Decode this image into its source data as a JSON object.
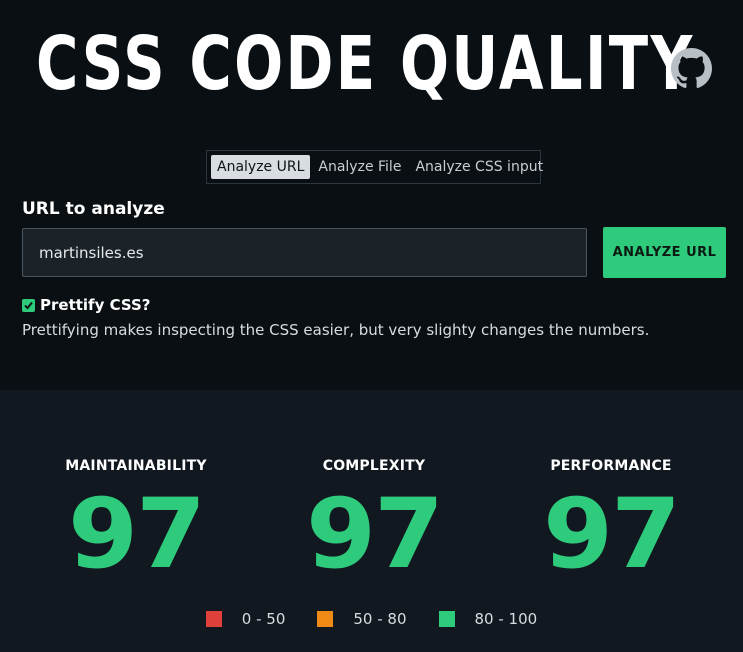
{
  "header": {
    "title": "CSS CODE QUALITY",
    "github_icon": "github-icon"
  },
  "tabs": [
    {
      "label": "Analyze URL",
      "active": true
    },
    {
      "label": "Analyze File",
      "active": false
    },
    {
      "label": "Analyze CSS input",
      "active": false
    }
  ],
  "form": {
    "url_label": "URL to analyze",
    "url_value": "martinsiles.es",
    "analyze_button": "ANALYZE URL",
    "prettify_label": "Prettify CSS?",
    "prettify_checked": true,
    "prettify_help": "Prettifying makes inspecting the CSS easier, but very slighty changes the numbers."
  },
  "scores": {
    "maintainability": {
      "label": "MAINTAINABILITY",
      "value": "97"
    },
    "complexity": {
      "label": "COMPLEXITY",
      "value": "97"
    },
    "performance": {
      "label": "PERFORMANCE",
      "value": "97"
    }
  },
  "legend": [
    {
      "range": "0 - 50",
      "color": "#e0403a"
    },
    {
      "range": "50 - 80",
      "color": "#ef8a17"
    },
    {
      "range": "80 - 100",
      "color": "#2ecb7c"
    }
  ],
  "colors": {
    "accent": "#2ecb7c",
    "background_top": "#0a0f13",
    "background_bottom": "#111820"
  }
}
